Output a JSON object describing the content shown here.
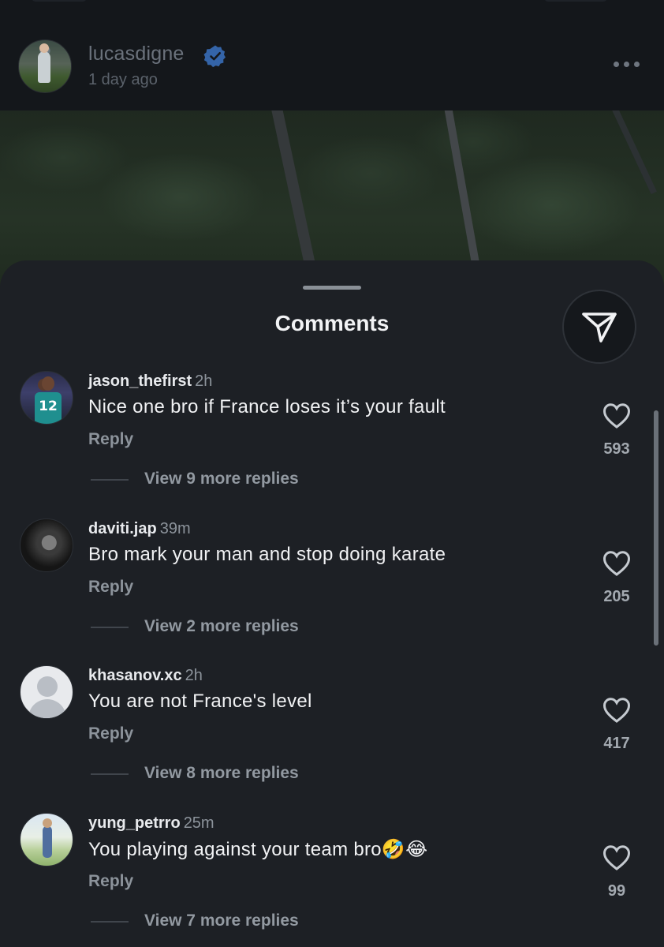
{
  "post": {
    "username": "lucasdigne",
    "time": "1 day ago"
  },
  "sheet": {
    "title": "Comments"
  },
  "comments": [
    {
      "user": "jason_thefirst",
      "time": "2h",
      "text": "Nice one bro if France loses it’s your fault",
      "reply_label": "Reply",
      "view_replies": "View 9 more replies",
      "likes": "593",
      "avatar_text": "12"
    },
    {
      "user": "daviti.jap",
      "time": "39m",
      "text": "Bro mark your man and stop doing karate",
      "reply_label": "Reply",
      "view_replies": "View 2 more replies",
      "likes": "205"
    },
    {
      "user": "khasanov.xc",
      "time": "2h",
      "text": "You are not France's level",
      "reply_label": "Reply",
      "view_replies": "View 8 more replies",
      "likes": "417"
    },
    {
      "user": "yung_petrro",
      "time": "25m",
      "text": "You playing against your team bro🤣😂",
      "reply_label": "Reply",
      "view_replies": "View 7 more replies",
      "likes": "99"
    }
  ],
  "icons": {
    "verified": "verified-badge-icon",
    "more": "more-options-icon",
    "share": "paper-plane-icon",
    "like": "heart-icon"
  },
  "colors": {
    "sheet_bg": "#1d2025",
    "verified": "#3f7fd8",
    "text_primary": "#f1f2f4",
    "text_secondary": "#8c939b"
  }
}
